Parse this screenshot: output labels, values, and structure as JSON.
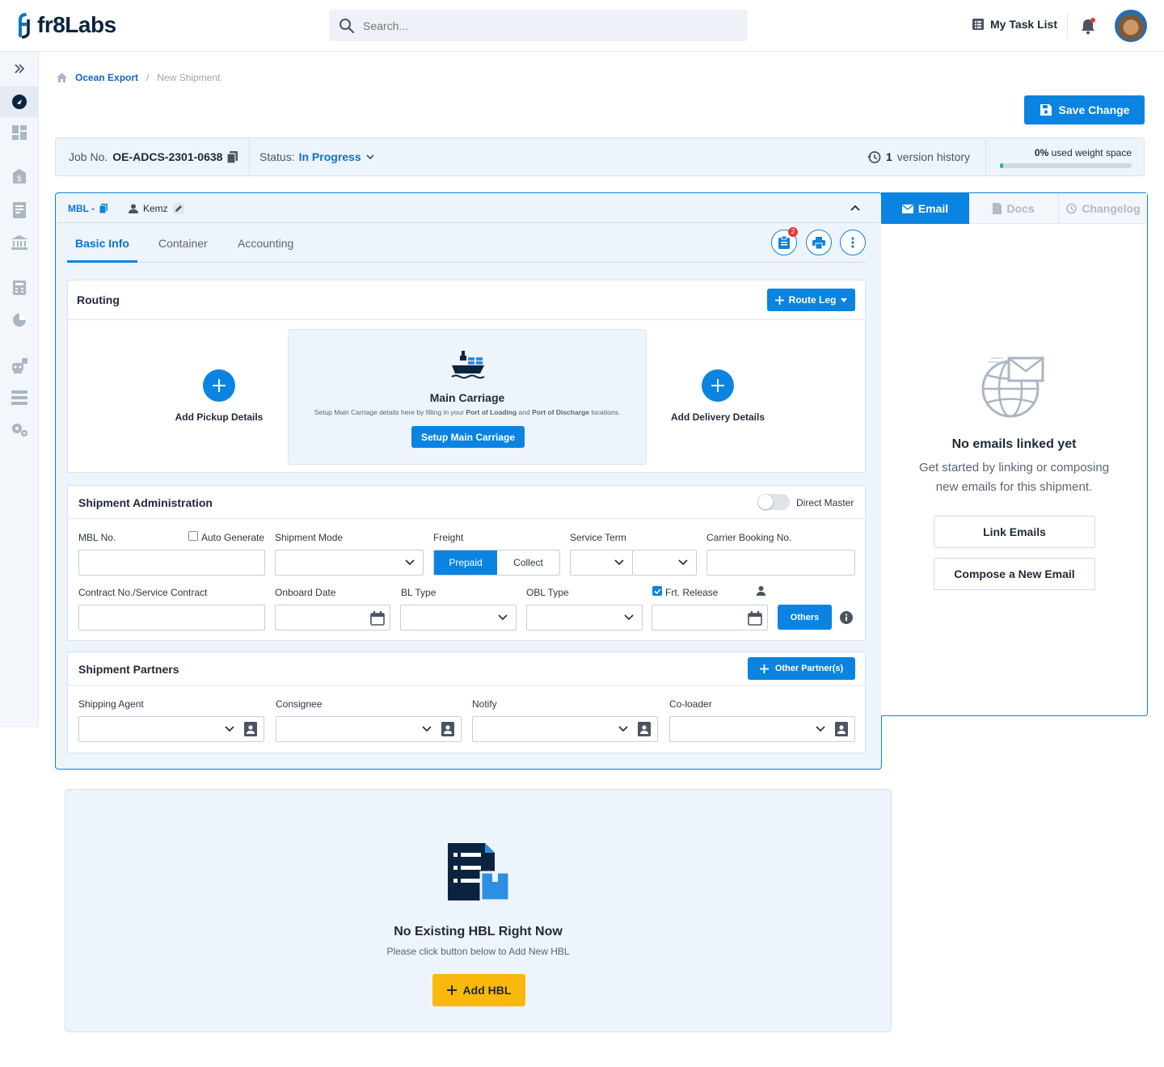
{
  "header": {
    "logo_text": "fr8Labs",
    "search_placeholder": "Search...",
    "task_list_label": "My Task List"
  },
  "sidebar": {
    "icons": [
      "expand-icon",
      "ocean-export-icon",
      "dashboard-icon",
      "finance-icon",
      "documents-icon",
      "bank-icon",
      "calculator-icon",
      "reports-icon",
      "robot-icon",
      "database-icon",
      "settings-icon"
    ]
  },
  "breadcrumb": {
    "parent": "Ocean Export",
    "separator": "/",
    "current": "New Shipment"
  },
  "save_button": "Save Change",
  "jobbar": {
    "job_label": "Job No.",
    "job_no": "OE-ADCS-2301-0638",
    "status_label": "Status:",
    "status_value": "In Progress",
    "version_count": "1",
    "version_label": "version history",
    "weight_pct": "0%",
    "weight_label": "used weight space",
    "weight_fill": 0.02
  },
  "card": {
    "mbl_label": "MBL -",
    "user": "Kemz",
    "tabs": [
      "Basic Info",
      "Container",
      "Accounting"
    ],
    "badge_count": "2"
  },
  "routing": {
    "title": "Routing",
    "route_leg_btn": "Route Leg",
    "pickup": "Add Pickup Details",
    "delivery": "Add Delivery Details",
    "main_title": "Main Carriage",
    "main_desc_1": "Setup Main Carriage details here by filling in your",
    "main_desc_pol": "Port of Loading",
    "main_desc_and": "and",
    "main_desc_pod": "Port of Discharge",
    "main_desc_2": "locations.",
    "main_btn": "Setup Main Carriage"
  },
  "admin": {
    "title": "Shipment Administration",
    "direct_master": "Direct Master",
    "mbl_no": "MBL No.",
    "auto_generate": "Auto Generate",
    "shipment_mode": "Shipment Mode",
    "freight": "Freight",
    "prepaid": "Prepaid",
    "collect": "Collect",
    "service_term": "Service Term",
    "carrier_booking": "Carrier Booking No.",
    "contract": "Contract No./Service Contract",
    "onboard_date": "Onboard Date",
    "bl_type": "BL Type",
    "obl_type": "OBL Type",
    "frt_release": "Frt. Release",
    "others_btn": "Others"
  },
  "partners": {
    "title": "Shipment Partners",
    "other_btn": "Other Partner(s)",
    "fields": [
      "Shipping Agent",
      "Consignee",
      "Notify",
      "Co-loader"
    ]
  },
  "right_panel": {
    "tabs": [
      "Email",
      "Docs",
      "Changelog"
    ],
    "empty_title": "No emails linked yet",
    "empty_line1": "Get started by linking or composing",
    "empty_line2": "new emails for this shipment.",
    "link_btn": "Link Emails",
    "compose_btn": "Compose a New Email"
  },
  "hbl": {
    "title": "No Existing HBL Right Now",
    "subtitle": "Please click button below to Add New HBL",
    "add_btn": "Add HBL"
  },
  "colors": {
    "primary": "#0a84e0",
    "navy": "#0c2340",
    "warning": "#fbb80c",
    "progress": "#22c55e",
    "badge": "#e53935"
  }
}
